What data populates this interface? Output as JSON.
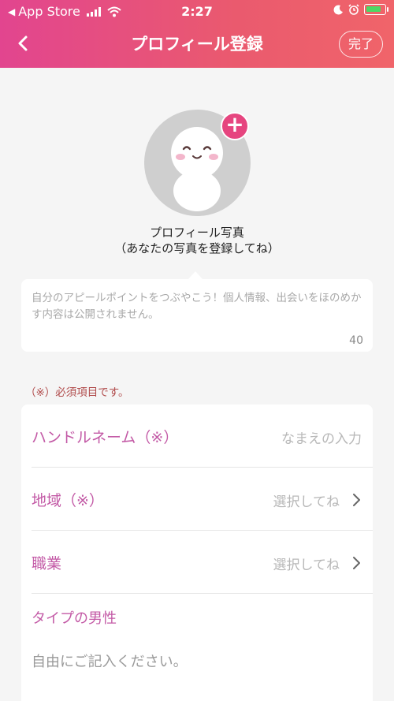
{
  "status_bar": {
    "back_app": "App Store",
    "time": "2:27"
  },
  "nav": {
    "title": "プロフィール登録",
    "done_label": "完了"
  },
  "photo": {
    "caption_line1": "プロフィール写真",
    "caption_line2": "（あなたの写真を登録してね）"
  },
  "bio": {
    "placeholder": "自分のアピールポイントをつぶやこう！個人情報、出会いをほのめかす内容は公開されません。",
    "char_count": "40"
  },
  "required_note": "（※）必須項目です。",
  "form": {
    "handle_label": "ハンドルネーム（※）",
    "handle_placeholder": "なまえの入力",
    "region_label": "地域（※）",
    "region_value": "選択してね",
    "job_label": "職業",
    "job_value": "選択してね",
    "type_label": "タイプの男性",
    "type_placeholder": "自由にご記入ください。"
  },
  "colors": {
    "header_gradient_start": "#e2458f",
    "header_gradient_end": "#f0646a",
    "label_pink": "#c35aa6",
    "required_red": "#b04a4a",
    "battery_green": "#4cd964"
  }
}
